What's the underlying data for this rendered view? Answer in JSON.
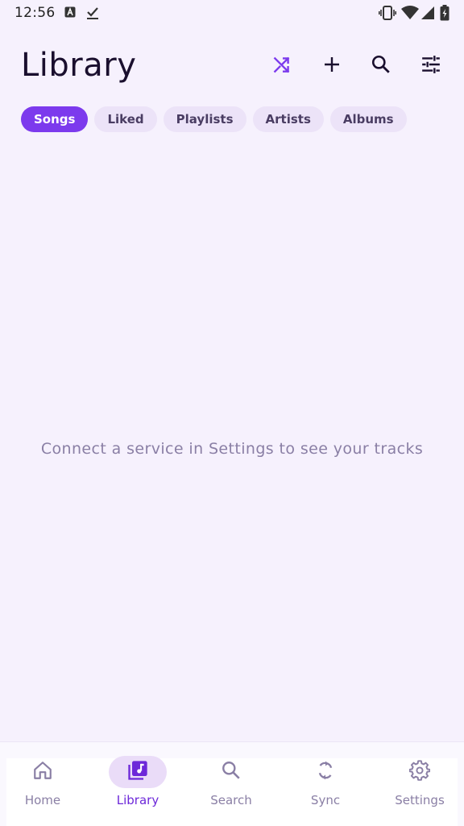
{
  "status_bar": {
    "time": "12:56",
    "icons": [
      "a-badge-icon",
      "download-check-icon",
      "vibrate-icon",
      "wifi-icon",
      "signal-icon",
      "battery-icon"
    ]
  },
  "header": {
    "title": "Library",
    "actions": [
      "shuffle-icon",
      "add-icon",
      "search-icon",
      "filter-tune-icon"
    ]
  },
  "filters": {
    "chips": [
      {
        "label": "Songs",
        "active": true
      },
      {
        "label": "Liked",
        "active": false
      },
      {
        "label": "Playlists",
        "active": false
      },
      {
        "label": "Artists",
        "active": false
      },
      {
        "label": "Albums",
        "active": false
      }
    ]
  },
  "main": {
    "empty_message": "Connect a service in Settings to see your tracks"
  },
  "bottom_nav": {
    "items": [
      {
        "label": "Home",
        "icon": "home-icon",
        "active": false
      },
      {
        "label": "Library",
        "icon": "library-music-icon",
        "active": true
      },
      {
        "label": "Search",
        "icon": "search-icon",
        "active": false
      },
      {
        "label": "Sync",
        "icon": "sync-icon",
        "active": false
      },
      {
        "label": "Settings",
        "icon": "settings-gear-icon",
        "active": false
      }
    ]
  },
  "colors": {
    "accent": "#7c3aed",
    "background": "#f6f1fd",
    "chip_bg": "#ece3f8",
    "muted_text": "#8a7fa5",
    "active_nav_bg": "#eadcf8"
  }
}
